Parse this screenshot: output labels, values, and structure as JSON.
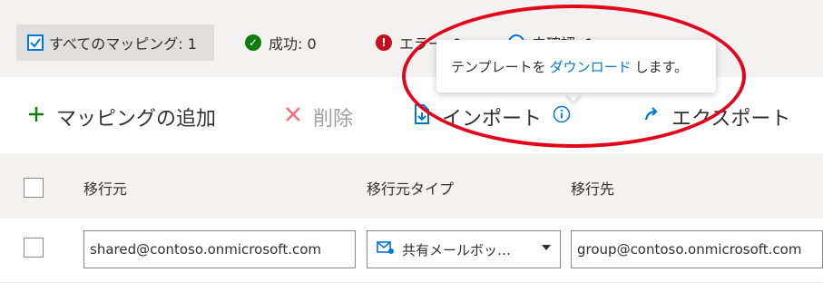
{
  "filters": {
    "all_label": "すべてのマッピング: 1",
    "success_label": "成功: 0",
    "error_label": "エラー: 0",
    "unverified_label": "未確認: 1"
  },
  "toolbar": {
    "add_label": "マッピングの追加",
    "delete_label": "削除",
    "import_label": "インポート",
    "export_label": "エクスポート"
  },
  "tooltip": {
    "prefix": "テンプレートを",
    "link": "ダウンロード",
    "suffix": "します。"
  },
  "table": {
    "headers": [
      "移行元",
      "移行元タイプ",
      "移行先"
    ],
    "rows": [
      {
        "source": "shared@contoso.onmicrosoft.com",
        "source_type": "共有メールボッ…",
        "target": "group@contoso.onmicrosoft.com"
      }
    ]
  },
  "colors": {
    "accent": "#0078d4",
    "success": "#107c10",
    "error": "#c50f1f",
    "highlight": "#e1061c",
    "add": "#107c10",
    "delete": "#e81123"
  }
}
